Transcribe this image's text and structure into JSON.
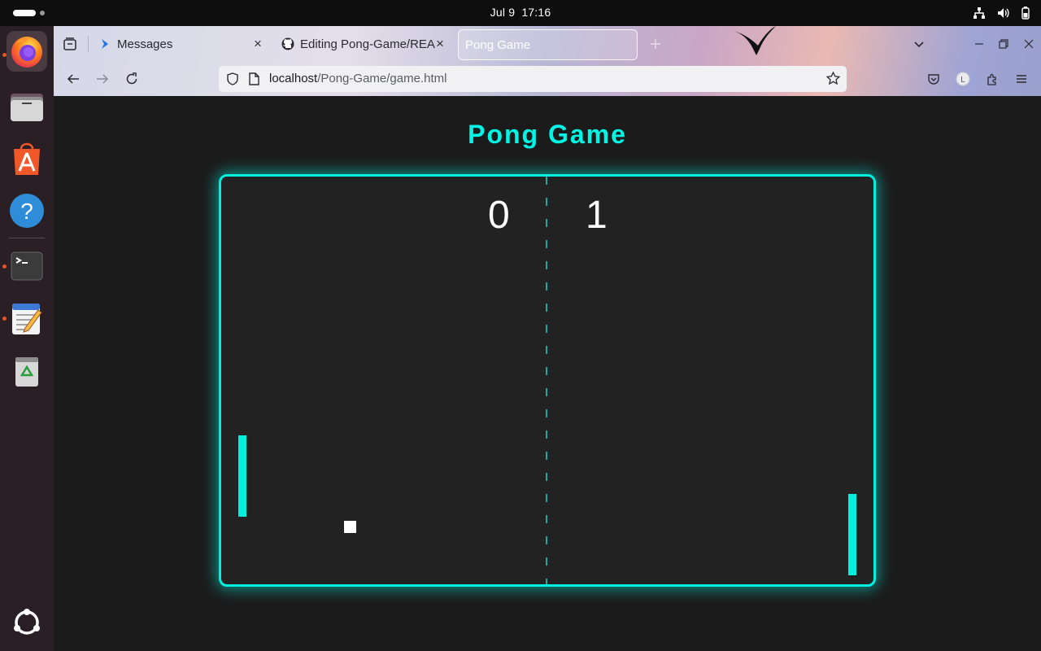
{
  "topbar": {
    "date": "Jul 9",
    "time": "17:16",
    "tray_icons": [
      "network-icon",
      "volume-icon",
      "battery-icon"
    ]
  },
  "dock": {
    "items": [
      "firefox-icon",
      "files-icon",
      "app-center-icon",
      "help-icon",
      "terminal-icon",
      "text-editor-icon",
      "trash-icon",
      "show-apps-icon"
    ]
  },
  "browser": {
    "tabs": [
      {
        "title": "Messages"
      },
      {
        "title": "Editing Pong-Game/README"
      },
      {
        "title": "Pong Game"
      }
    ],
    "url_host": "localhost",
    "url_path": "/Pong-Game/game.html"
  },
  "game": {
    "title": "Pong Game",
    "score_left": "0",
    "score_right": "1",
    "accent_color": "#00f0e0"
  }
}
